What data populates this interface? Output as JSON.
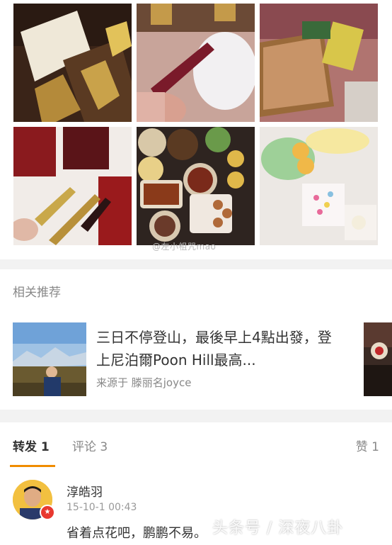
{
  "photo_grid": {
    "watermark": "@左小祖咒mao",
    "tiles": [
      "gift-box-photo",
      "lipstick-fur-photo",
      "puzzle-snacks-photo",
      "lipsticks-photo",
      "dimsum-photo",
      "dessert-photo"
    ]
  },
  "related": {
    "section_title": "相关推荐",
    "item": {
      "title": "三日不停登山，最後早上4點出發，登上尼泊爾Poon Hill最高...",
      "source": "来源于 滕丽名joyce"
    }
  },
  "tabs": {
    "repost": "转发 1",
    "comments": "评论 3",
    "likes": "赞 1"
  },
  "comment": {
    "author": "淳皓羽",
    "time": "15-10-1 00:43",
    "text": "省着点花吧，鹏鹏不易。"
  },
  "overlay_watermark": "头条号 / 深夜八卦",
  "colors": {
    "tab_underline": "#f08c00",
    "badge": "#e8382f"
  }
}
